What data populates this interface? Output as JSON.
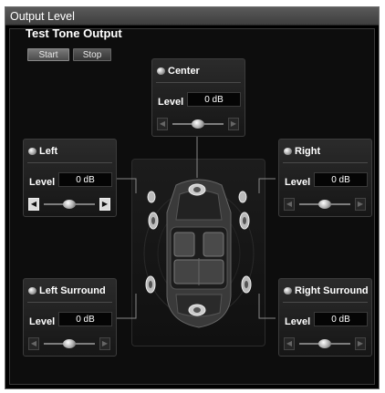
{
  "window": {
    "title": "Output Level"
  },
  "test_tone": {
    "title": "Test Tone Output",
    "start_label": "Start",
    "stop_label": "Stop"
  },
  "level_label": "Level",
  "channels": {
    "center": {
      "name": "Center",
      "value": "0 dB",
      "level": 0.5
    },
    "left": {
      "name": "Left",
      "value": "0 dB",
      "level": 0.5
    },
    "right": {
      "name": "Right",
      "value": "0 dB",
      "level": 0.5
    },
    "left_surround": {
      "name": "Left Surround",
      "value": "0 dB",
      "level": 0.5
    },
    "right_surround": {
      "name": "Right Surround",
      "value": "0 dB",
      "level": 0.5
    }
  }
}
